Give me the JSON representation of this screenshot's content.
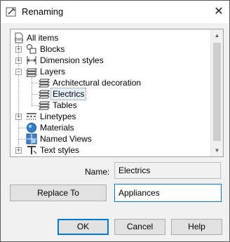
{
  "window": {
    "title": "Renaming",
    "close_glyph": "✕"
  },
  "tree": {
    "items": [
      {
        "label": "All items",
        "icon": "dwg-icon"
      },
      {
        "label": "Blocks",
        "icon": "blocks-icon"
      },
      {
        "label": "Dimension styles",
        "icon": "dimension-styles-icon"
      },
      {
        "label": "Layers",
        "icon": "layers-icon"
      },
      {
        "label": "Architectural decoration",
        "icon": "layer-icon"
      },
      {
        "label": "Electrics",
        "icon": "layer-icon",
        "selected": true
      },
      {
        "label": "Tables",
        "icon": "layer-icon"
      },
      {
        "label": "Linetypes",
        "icon": "linetypes-icon"
      },
      {
        "label": "Materials",
        "icon": "materials-icon"
      },
      {
        "label": "Named Views",
        "icon": "named-views-icon"
      },
      {
        "label": "Text styles",
        "icon": "text-styles-icon"
      }
    ],
    "expander_plus": "+",
    "expander_minus": "−"
  },
  "form": {
    "name_label": "Name:",
    "name_value": "Electrics",
    "replace_label": "Replace To",
    "replace_value": "Appliances"
  },
  "buttons": {
    "ok": "OK",
    "cancel": "Cancel",
    "help": "Help"
  },
  "colors": {
    "accent": "#0078d7",
    "selection": "#e5f1fb"
  }
}
